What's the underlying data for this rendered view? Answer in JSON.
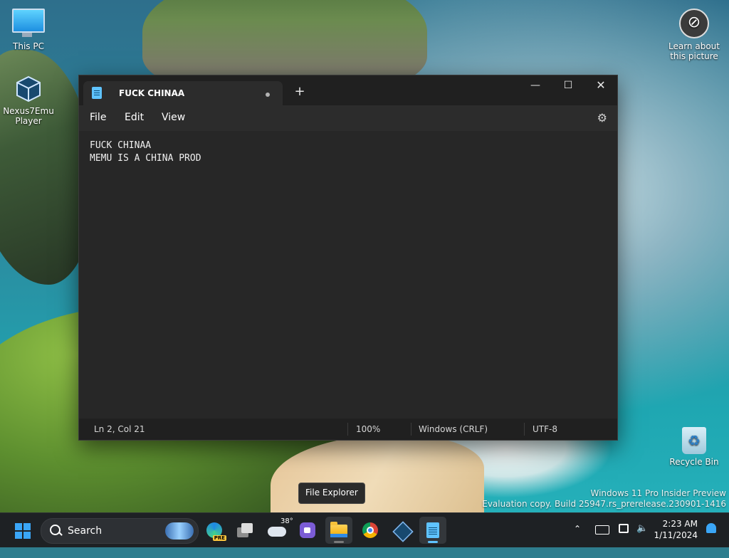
{
  "desktop": {
    "icons": [
      {
        "label": "This PC"
      },
      {
        "label": "Nexus7Emu Player"
      },
      {
        "label": "Learn about this picture"
      },
      {
        "label": "Recycle Bin"
      }
    ],
    "watermark": {
      "line1": "Windows 11 Pro Insider Preview",
      "line2": "Evaluation copy. Build 25947.rs_prerelease.230901-1416"
    }
  },
  "notepad": {
    "tab_title": "FUCK CHINAA",
    "menu": {
      "file": "File",
      "edit": "Edit",
      "view": "View"
    },
    "content": {
      "line1": "FUCK CHINAA",
      "line2": "MEMU IS A CHINA PROD"
    },
    "status": {
      "position": "Ln 2, Col 21",
      "zoom": "100%",
      "line_ending": "Windows (CRLF)",
      "encoding": "UTF-8"
    }
  },
  "tooltip": "File Explorer",
  "taskbar": {
    "search_label": "Search",
    "weather_temp": "38°",
    "clock_time": "2:23 AM",
    "clock_date": "1/11/2024"
  },
  "colors": {
    "accent": "#5fc3ff",
    "window_bg": "#272727",
    "taskbar_bg": "#1e2124"
  }
}
